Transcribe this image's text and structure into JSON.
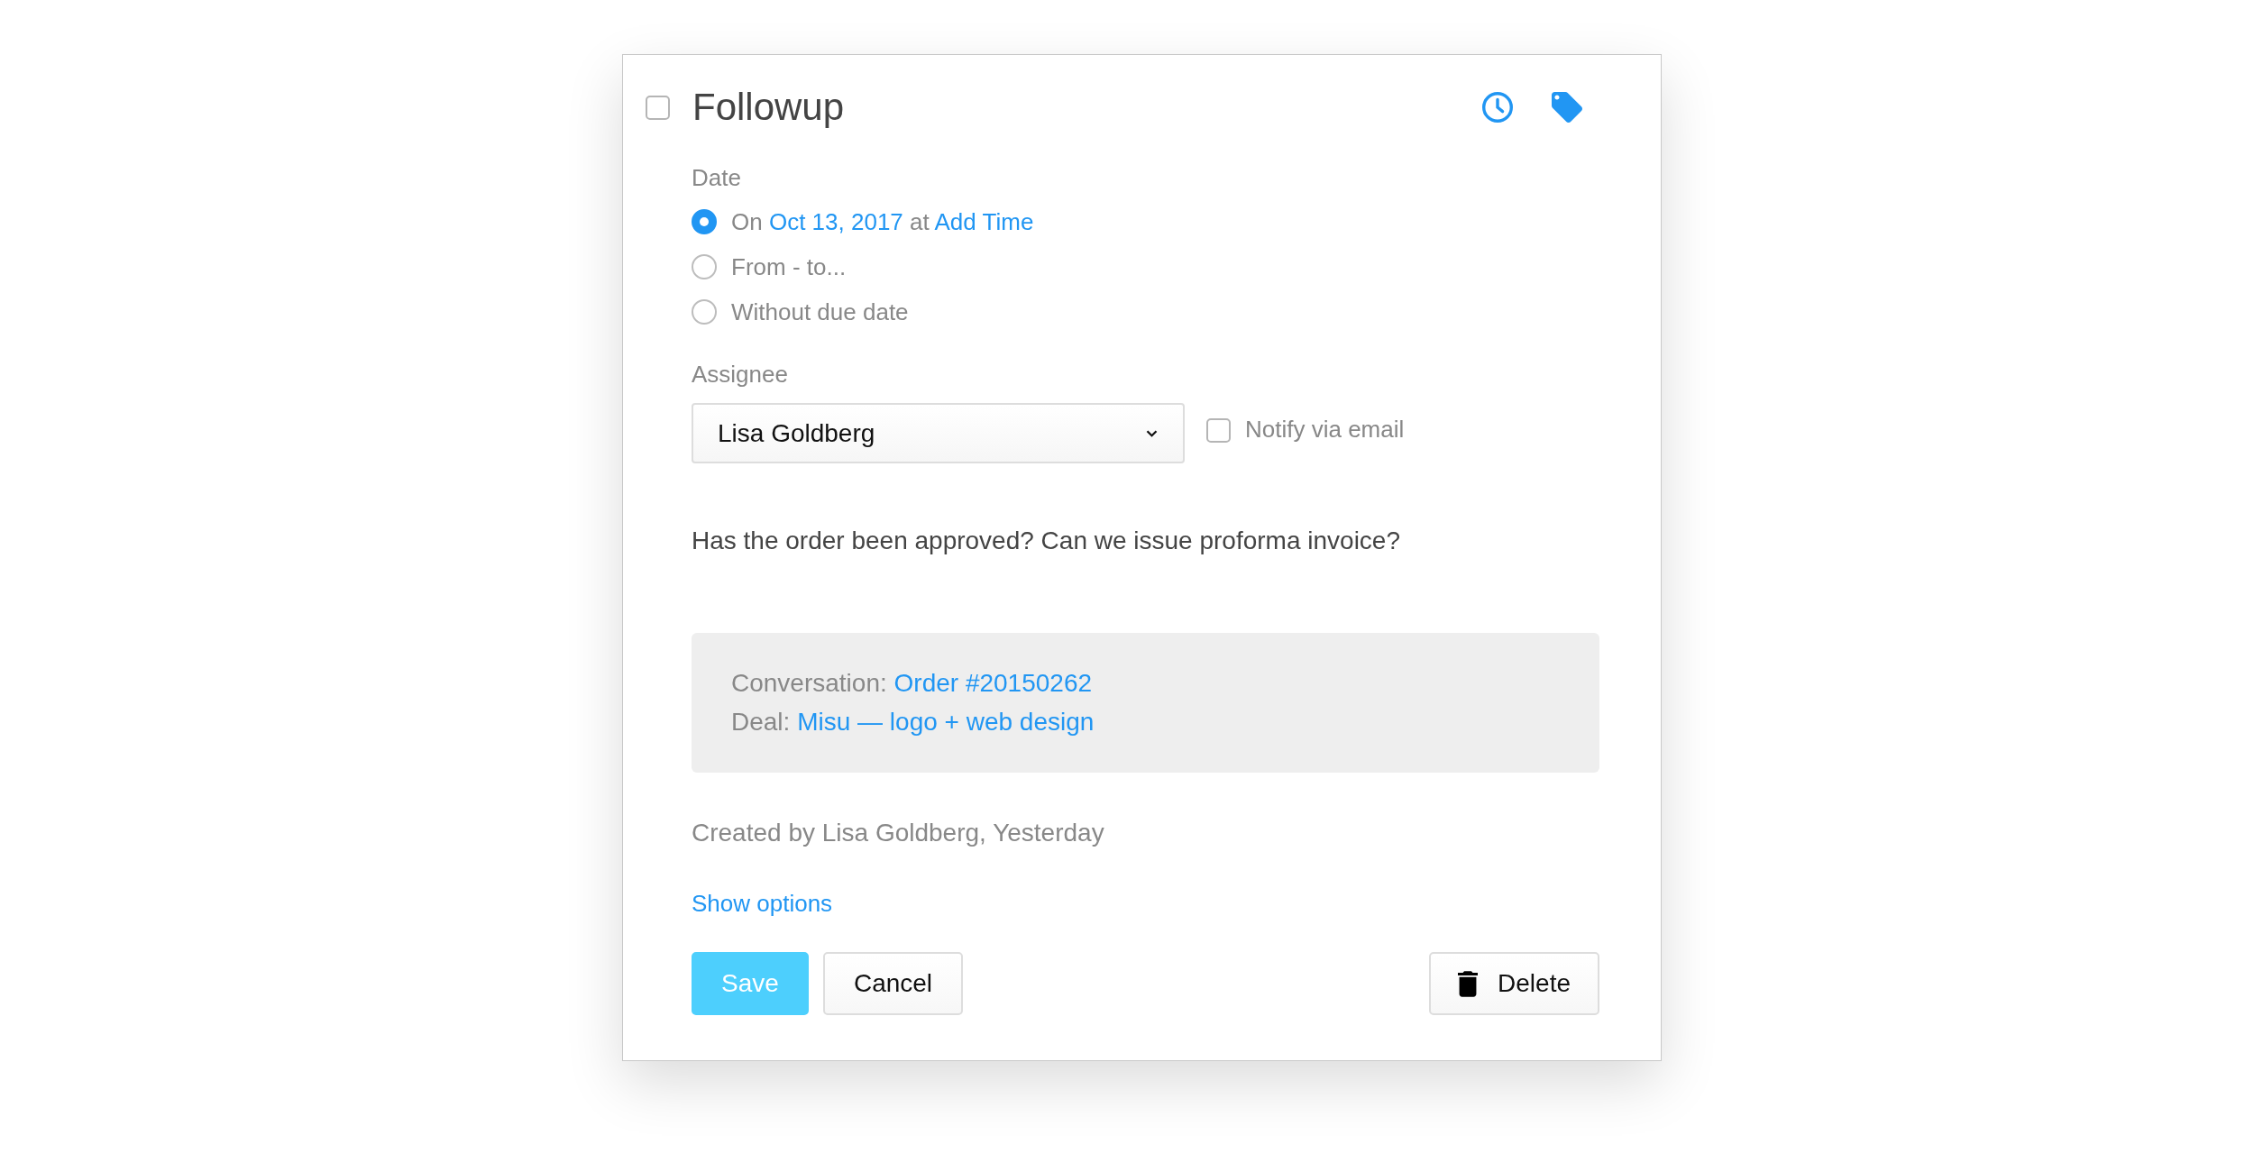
{
  "task": {
    "title": "Followup",
    "completed": false
  },
  "date": {
    "label": "Date",
    "options": [
      {
        "kind": "date",
        "selected": true,
        "prefix": "On",
        "date": "Oct 13, 2017",
        "connector": "at",
        "time_link": "Add Time"
      },
      {
        "kind": "text",
        "selected": false,
        "text": "From - to..."
      },
      {
        "kind": "text",
        "selected": false,
        "text": "Without due date"
      }
    ]
  },
  "assignee": {
    "label": "Assignee",
    "value": "Lisa Goldberg",
    "notify": {
      "label": "Notify via email",
      "checked": false
    }
  },
  "description": "Has the order been approved? Can we issue proforma invoice?",
  "linked_items": [
    {
      "label": "Conversation:",
      "link": "Order #20150262"
    },
    {
      "label": "Deal:",
      "link": "Misu — logo + web design"
    }
  ],
  "created": "Created by Lisa Goldberg, Yesterday",
  "show_options": "Show options",
  "buttons": [
    {
      "kind": "primary",
      "label": "Save"
    },
    {
      "kind": "default",
      "label": "Cancel"
    },
    {
      "kind": "delete",
      "label": "Delete"
    }
  ]
}
